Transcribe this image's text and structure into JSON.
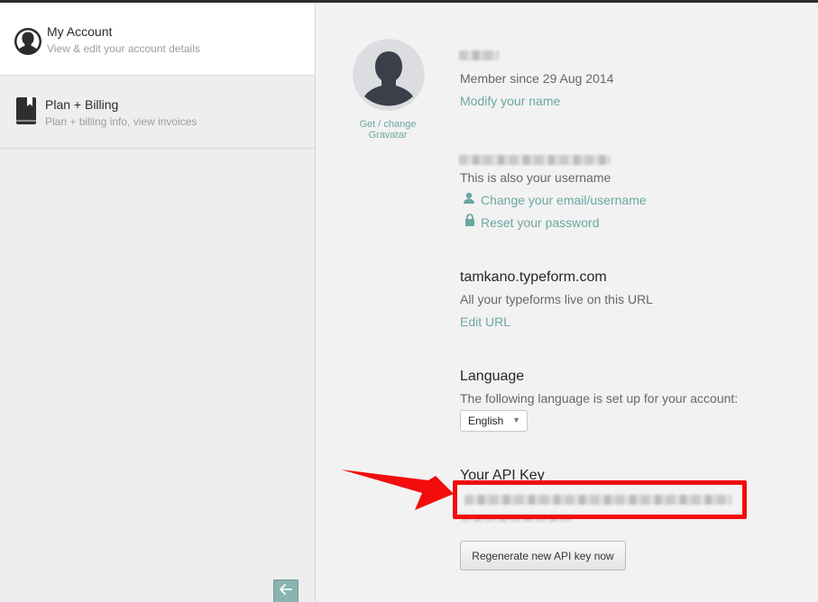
{
  "sidebar": {
    "items": [
      {
        "title": "My Account",
        "subtitle": "View & edit your account details",
        "icon": "user-silhouette-icon",
        "active": true
      },
      {
        "title": "Plan + Billing",
        "subtitle": "Plan + billing info, view invoices",
        "icon": "bookmark-book-icon",
        "active": false
      }
    ],
    "collapse_icon": "arrow-left-icon"
  },
  "profile": {
    "gravatar_link": "Get / change Gravatar",
    "member_since": "Member since 29 Aug 2014",
    "modify_name": "Modify your name"
  },
  "email": {
    "username_note": "This is also your username",
    "change_email": "Change your email/username",
    "reset_password": "Reset your password"
  },
  "url": {
    "domain": "tamkano.typeform.com",
    "description": "All your typeforms live on this URL",
    "edit": "Edit URL"
  },
  "language": {
    "heading": "Language",
    "description": "The following language is set up for your account:",
    "selected": "English"
  },
  "api": {
    "heading": "Your API Key",
    "regenerate": "Regenerate new API key now"
  },
  "colors": {
    "link": "#6ca7a2",
    "annotation": "#f20c0c"
  }
}
